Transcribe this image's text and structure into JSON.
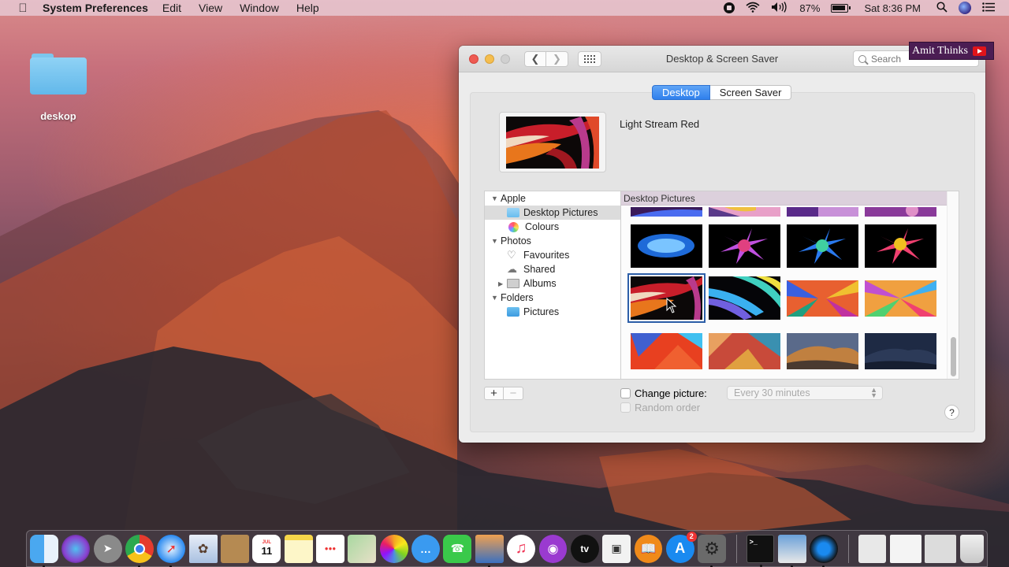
{
  "menubar": {
    "app_name": "System Preferences",
    "menus": [
      "Edit",
      "View",
      "Window",
      "Help"
    ],
    "battery_percent": "87%",
    "clock": "Sat 8:36 PM",
    "status_icons": [
      "screen-record-icon",
      "wifi-icon",
      "volume-icon",
      "battery-icon",
      "spotlight-search-icon",
      "siri-icon",
      "notification-center-icon"
    ]
  },
  "desktop": {
    "folder_label": "deskop"
  },
  "watermark": {
    "text": "Amit Thinks"
  },
  "window": {
    "title": "Desktop & Screen Saver",
    "search_placeholder": "Search",
    "tabs": [
      {
        "label": "Desktop",
        "active": true
      },
      {
        "label": "Screen Saver",
        "active": false
      }
    ],
    "current_picture_name": "Light Stream Red",
    "sidebar": {
      "groups": [
        {
          "label": "Apple",
          "expanded": true,
          "items": [
            {
              "label": "Desktop Pictures",
              "icon": "folder-icon",
              "selected": true
            },
            {
              "label": "Colours",
              "icon": "color-wheel-icon",
              "selected": false
            }
          ]
        },
        {
          "label": "Photos",
          "expanded": true,
          "items": [
            {
              "label": "Favourites",
              "icon": "heart-icon",
              "selected": false
            },
            {
              "label": "Shared",
              "icon": "cloud-icon",
              "selected": false
            },
            {
              "label": "Albums",
              "icon": "album-folder-icon",
              "selected": false,
              "collapsed": true
            }
          ]
        },
        {
          "label": "Folders",
          "expanded": true,
          "items": [
            {
              "label": "Pictures",
              "icon": "pictures-folder-icon",
              "selected": false
            }
          ]
        }
      ]
    },
    "grid": {
      "header": "Desktop Pictures",
      "selected_index": 8,
      "scroll_position": "bottom"
    },
    "add_label": "+",
    "remove_label": "−",
    "change_picture": {
      "label": "Change picture:",
      "checked": false,
      "interval": "Every 30 minutes"
    },
    "random_order": {
      "label": "Random order",
      "checked": false,
      "enabled": false
    },
    "help_label": "?"
  },
  "dock": {
    "apps": [
      "Finder",
      "Siri",
      "Launchpad",
      "Google Chrome",
      "Safari",
      "Mail",
      "Contacts",
      "Calendar",
      "Notes",
      "Reminders",
      "Maps",
      "Photos",
      "Messages",
      "FaceTime",
      "Keynote",
      "Music",
      "Podcasts",
      "TV",
      "Screenshot",
      "Books",
      "App Store",
      "System Preferences",
      "Terminal",
      "Preview",
      "QuickTime Player",
      "Downloads",
      "Chrome window",
      "Preview window",
      "Trash"
    ],
    "calendar_day": "11",
    "calendar_month": "JUL",
    "app_store_badge": "2",
    "tv_label": "tv"
  },
  "colors": {
    "accent_blue": "#2f80ed",
    "selection_outline": "#2d5fa8",
    "traffic_close": "#ee5a52",
    "traffic_min": "#f5be4f",
    "watermark_bg": "#4b1d53",
    "youtube_red": "#e0141a"
  }
}
